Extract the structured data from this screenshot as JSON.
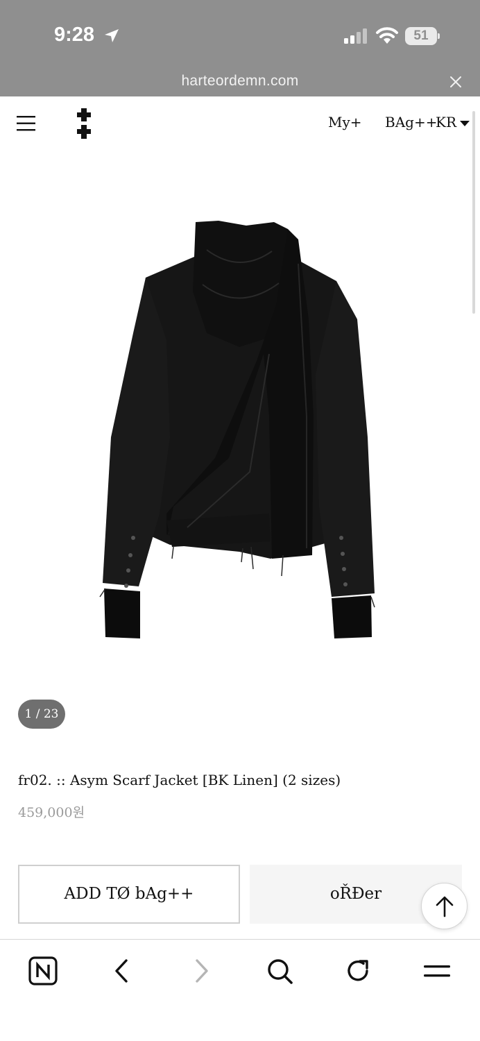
{
  "status_bar": {
    "time": "9:28",
    "battery": "51"
  },
  "browser": {
    "url": "harteordemn.com"
  },
  "header": {
    "my_label": "My+",
    "bag_label": "BAg++",
    "lang_label": "KR"
  },
  "gallery": {
    "counter": "1 / 23"
  },
  "product": {
    "title": "fr02. :: Asym Scarf Jacket [BK Linen] (2 sizes)",
    "price": "459,000원"
  },
  "actions": {
    "add_label": "ADD TØ bAg++",
    "order_label": "oŘĐer"
  },
  "icons": {
    "location": "location-arrow-icon",
    "signal": "cellular-signal-icon",
    "wifi": "wifi-icon",
    "close": "close-icon",
    "menu": "hamburger-menu-icon",
    "logo": "double-cross-logo",
    "scroll_top": "arrow-up-icon",
    "naver": "naver-n-icon",
    "back": "chevron-left-icon",
    "forward": "chevron-right-icon",
    "search": "search-icon",
    "reload": "reload-icon",
    "browser_menu": "menu-icon"
  },
  "colors": {
    "chrome_gray": "#8f8f8f",
    "counter_bg": "#6f6f6f",
    "price_gray": "#9a9a9a"
  }
}
